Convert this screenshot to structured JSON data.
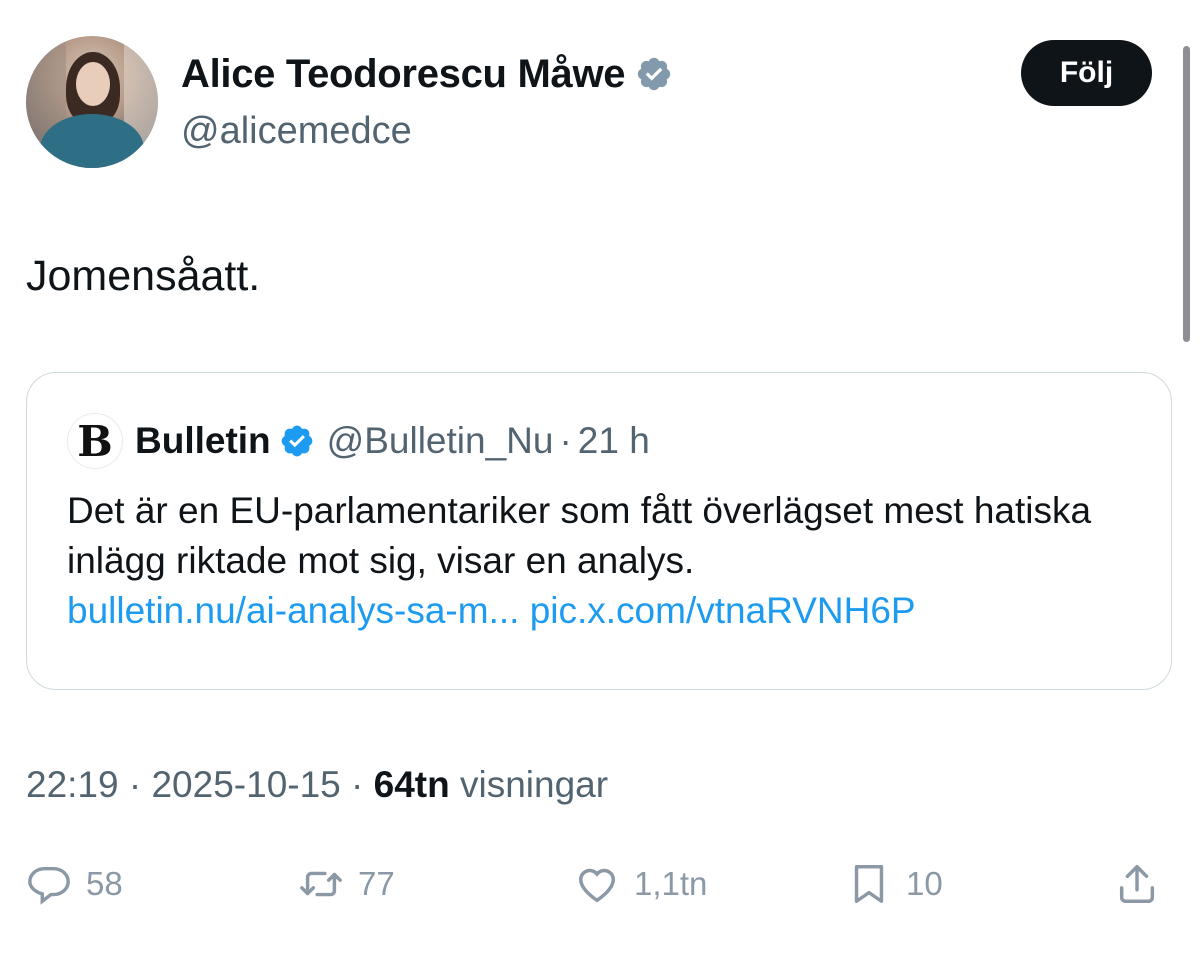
{
  "author": {
    "display_name": "Alice Teodorescu Måwe",
    "handle": "@alicemedce",
    "verified_color": "#829aab"
  },
  "follow_label": "Följ",
  "tweet_text": "Jomensåatt.",
  "quote": {
    "logo_letter": "B",
    "name": "Bulletin",
    "handle": "@Bulletin_Nu",
    "sep": "·",
    "time": "21 h",
    "verified_color": "#1d9bf0",
    "text": "Det är en EU-parlamentariker som fått överlägset mest hatiska inlägg riktade mot sig, visar en analys.",
    "link1": "bulletin.nu/ai-analys-sa-m...",
    "link2": "pic.x.com/vtnaRVNH6P"
  },
  "meta": {
    "time": "22:19",
    "sep": "·",
    "date": "2025-10-15",
    "views_count": "64tn",
    "views_label": "visningar"
  },
  "actions": {
    "replies": "58",
    "reposts": "77",
    "likes": "1,1tn",
    "bookmarks": "10"
  },
  "icons": [
    "reply-icon",
    "repost-icon",
    "like-icon",
    "bookmark-icon",
    "share-icon",
    "verified-badge-icon"
  ]
}
